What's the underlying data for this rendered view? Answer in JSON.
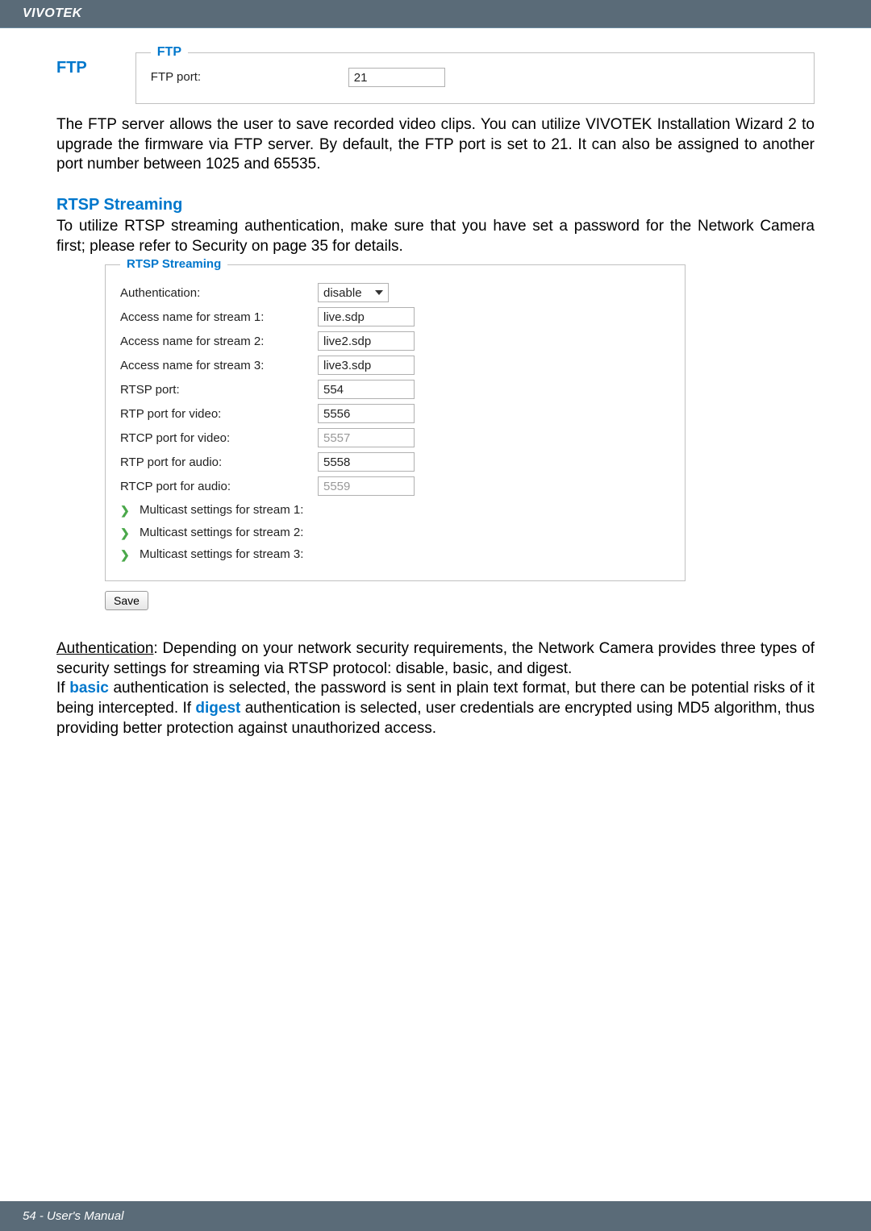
{
  "header": {
    "brand": "VIVOTEK"
  },
  "ftp": {
    "side_title": "FTP",
    "legend": "FTP",
    "port_label": "FTP port:",
    "port_value": "21",
    "description": "The FTP server allows the user to save recorded video clips. You can utilize VIVOTEK Installation Wizard 2 to upgrade the firmware via FTP server. By default, the FTP port is set to 21. It can also be assigned to another port number between 1025 and 65535."
  },
  "rtsp": {
    "title": "RTSP Streaming",
    "intro": "To utilize RTSP streaming authentication, make sure that you have set a password for the Network Camera first; please refer to Security on page 35 for details.",
    "legend": "RTSP Streaming",
    "rows": {
      "auth_label": "Authentication:",
      "auth_value": "disable",
      "s1_label": "Access name for stream 1:",
      "s1_value": "live.sdp",
      "s2_label": "Access name for stream 2:",
      "s2_value": "live2.sdp",
      "s3_label": "Access name for stream 3:",
      "s3_value": "live3.sdp",
      "rtsp_port_label": "RTSP port:",
      "rtsp_port_value": "554",
      "rtp_video_label": "RTP port for video:",
      "rtp_video_value": "5556",
      "rtcp_video_label": "RTCP port for video:",
      "rtcp_video_value": "5557",
      "rtp_audio_label": "RTP port for audio:",
      "rtp_audio_value": "5558",
      "rtcp_audio_label": "RTCP port for audio:",
      "rtcp_audio_value": "5559"
    },
    "multicast": {
      "m1": "Multicast settings for stream 1:",
      "m2": "Multicast settings for stream 2:",
      "m3": "Multicast settings for stream 3:"
    },
    "save_label": "Save"
  },
  "explain": {
    "auth_label": "Authentication",
    "auth_rest": ": Depending on your network security requirements, the Network Camera provides three types of security settings for streaming via RTSP protocol: disable, basic, and digest.",
    "line2_prefix": "If ",
    "basic": "basic",
    "line2_mid": " authentication is selected, the password is sent in plain text format, but there can be potential risks of it being intercepted. If ",
    "digest": "digest",
    "line2_end": " authentication is selected, user credentials are encrypted using MD5 algorithm, thus providing better protection against unauthorized access."
  },
  "footer": {
    "text": "54 - User's Manual"
  }
}
